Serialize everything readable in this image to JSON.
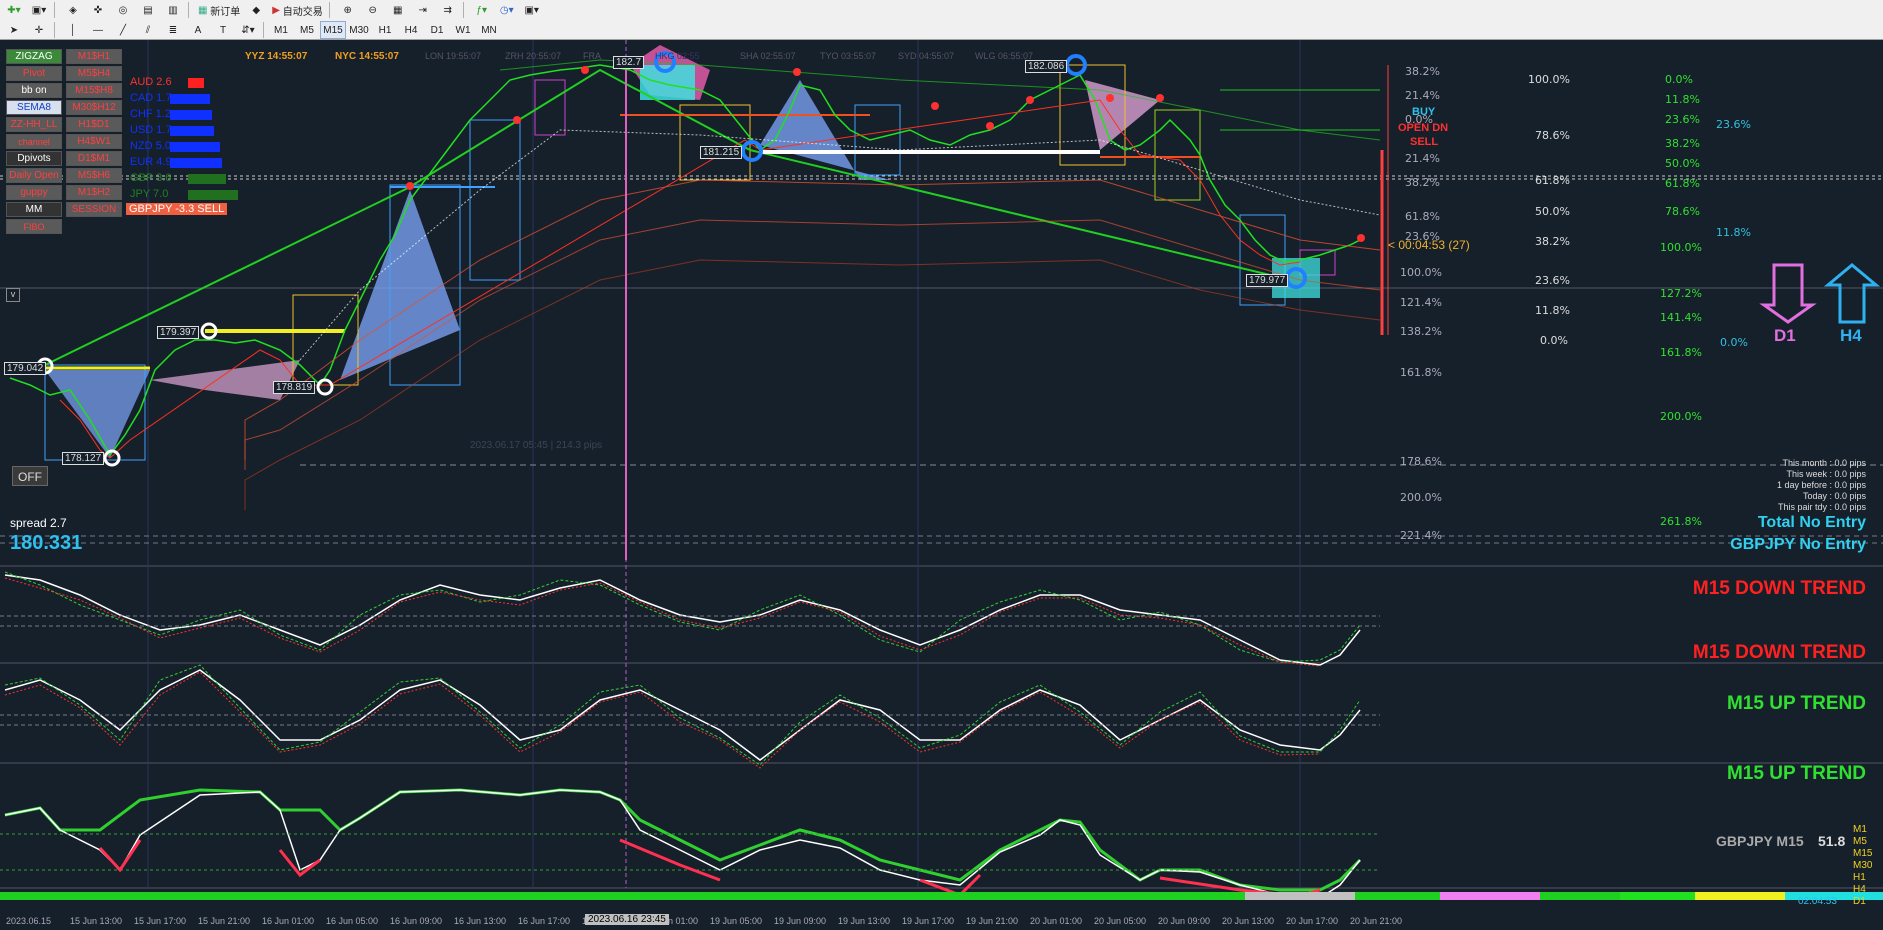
{
  "toolbar": {
    "new_order": "新订单",
    "auto_trade": "自动交易",
    "timeframes": [
      "M1",
      "M5",
      "M15",
      "M30",
      "H1",
      "H4",
      "D1",
      "W1",
      "MN"
    ],
    "active_timeframe": "M15"
  },
  "sessions": {
    "yyz": "YYZ 14:55:07",
    "nyc": "NYC 14:55:07",
    "lon": "LON 19:55:07",
    "zrh": "ZRH 20:55:07",
    "fra": "FRA",
    "hkg": "HKG 02:55",
    "sha": "SHA 02:55:07",
    "tyo": "TYO 03:55:07",
    "syd": "SYD 04:55:07",
    "wlg": "WLG 06:55:07"
  },
  "left_panel": {
    "col1": [
      "ZIGZAG",
      "Pivot",
      "bb on",
      "SEMA8",
      "ZZ-HH_LL",
      "channel",
      "Dpivots",
      "Daily Open",
      "guppy",
      "MM",
      "FIBO"
    ],
    "col2": [
      "M1$H1",
      "M5$H4",
      "M15$H8",
      "M30$H12",
      "H1$D1",
      "H4$W1",
      "D1$M1",
      "M5$H6",
      "M1$H2",
      "SESSION"
    ],
    "off": "OFF",
    "spread": "spread 2.7",
    "bid": "180.331"
  },
  "currency_strength": [
    {
      "label": "AUD  2.6"
    },
    {
      "label": "CAD  1.7"
    },
    {
      "label": "CHF  1.2"
    },
    {
      "label": "USD  1.7"
    },
    {
      "label": "NZD  5.0"
    },
    {
      "label": "EUR  4.9"
    },
    {
      "label": "GBP  3.6"
    },
    {
      "label": "JPY  7.0"
    }
  ],
  "pair_signal": "GBPJPY -3.3 SELL",
  "price_labels": {
    "p1": "182.7",
    "p2": "182.086",
    "p3": "181.215",
    "p4": "179.397",
    "p5": "179.042",
    "p6": "178.819",
    "p7": "179.977",
    "p8": "178.127"
  },
  "countdown": "< 00:04:53 (27)",
  "buy_label": "BUY",
  "open_dn_label": "OPEN DN",
  "sell_label": "SELL",
  "fib_col1": [
    "38.2%",
    "21.4%",
    "0.0%",
    "21.4%",
    "38.2%",
    "61.8%",
    "23.6%",
    "100.0%",
    "121.4%",
    "138.2%",
    "161.8%",
    "178.6%",
    "200.0%",
    "221.4%"
  ],
  "fib_col2": [
    "100.0%",
    "78.6%",
    "61.8%",
    "50.0%",
    "38.2%",
    "23.6%",
    "11.8%",
    "0.0%"
  ],
  "fib_col3": [
    "0.0%",
    "11.8%",
    "23.6%",
    "38.2%",
    "50.0%",
    "61.8%",
    "78.6%",
    "100.0%",
    "127.2%",
    "141.4%",
    "161.8%",
    "200.0%",
    "261.8%"
  ],
  "fib_col4": [
    "23.6%",
    "11.8%",
    "0.0%"
  ],
  "arrows": {
    "d1": "D1",
    "h4": "H4"
  },
  "stats": [
    "This month : 0.0 pips",
    "This week : 0.0 pips",
    "1 day before : 0.0 pips",
    "Today : 0.0 pips",
    "This pair tdy : 0.0 pips"
  ],
  "total_no_entry": "Total No Entry",
  "pair_no_entry": "GBPJPY No Entry",
  "trends": [
    "M15 DOWN TREND",
    "M15 DOWN TREND",
    "M15 UP TREND",
    "M15 UP TREND"
  ],
  "rsi_label": "GBPJPY M15",
  "rsi_value": "51.8",
  "tf_list": [
    "M1",
    "M5",
    "M15",
    "M30",
    "H1",
    "H4",
    "D1"
  ],
  "watermark": "2023.06.17 05:45 | 214.3 pips",
  "time_axis": [
    "2023.06.15",
    "15 Jun 13:00",
    "15 Jun 17:00",
    "15 Jun 21:00",
    "16 Jun 01:00",
    "16 Jun 05:00",
    "16 Jun 09:00",
    "16 Jun 13:00",
    "16 Jun 17:00",
    "16 Jun 21:00",
    "19 Jun 01:00",
    "19 Jun 05:00",
    "19 Jun 09:00",
    "19 Jun 13:00",
    "19 Jun 17:00",
    "19 Jun 21:00",
    "20 Jun 01:00",
    "20 Jun 05:00",
    "20 Jun 09:00",
    "20 Jun 13:00",
    "20 Jun 17:00",
    "20 Jun 21:00"
  ],
  "time_highlight": "2023.06.16 23:45",
  "clock": "02:04:53"
}
